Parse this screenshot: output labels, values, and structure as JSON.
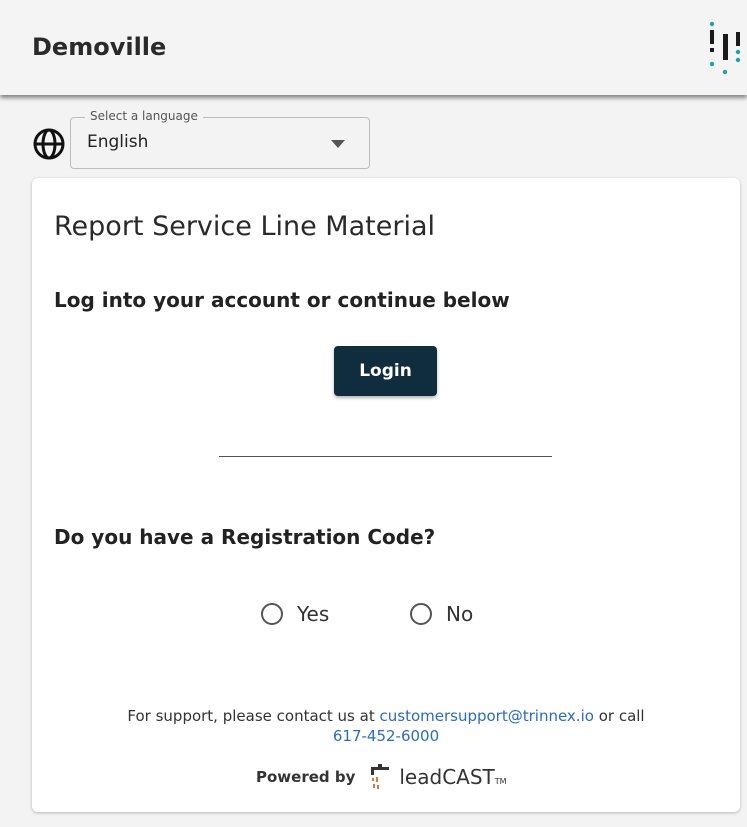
{
  "header": {
    "title": "Demoville",
    "brand_icon": "trinnex-dots-icon"
  },
  "language": {
    "label": "Select a language",
    "value": "English",
    "icon": "globe-icon"
  },
  "card": {
    "title": "Report Service Line Material",
    "login_heading": "Log into your account or continue below",
    "login_button": "Login",
    "registration_heading": "Do you have a Registration Code?",
    "options": [
      {
        "label": "Yes",
        "selected": false
      },
      {
        "label": "No",
        "selected": false
      }
    ],
    "support": {
      "prefix": "For support, please contact us at",
      "email": "customersupport@trinnex.io",
      "middle": "or call",
      "phone": "617-452-6000"
    },
    "powered": {
      "label": "Powered by",
      "brand_a": "lead",
      "brand_b": "CAST",
      "brand_tm": "TM"
    }
  },
  "colors": {
    "primary_button": "#0f2d3c",
    "link": "#2a6bc4",
    "accent_teal": "#1aa3a8"
  }
}
